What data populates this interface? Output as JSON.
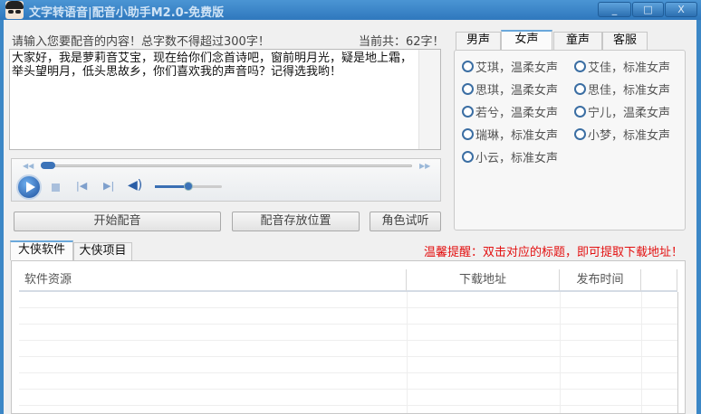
{
  "window": {
    "title": "文字转语音|配音小助手M2.0-免费版",
    "controls": [
      "_",
      "□",
      "X"
    ]
  },
  "input": {
    "prompt": "请输入您要配音的内容！总字数不得超过300字！",
    "count": "当前共：62字！",
    "text": "大家好，我是萝莉音艾宝，现在给你们念首诗吧，窗前明月光，疑是地上霜，举头望明月，低头思故乡，你们喜欢我的声音吗？记得选我哟！"
  },
  "player": {
    "progress": 0.0,
    "volume": 0.5
  },
  "buttons": {
    "start": "开始配音",
    "location": "配音存放位置",
    "preview": "角色试听"
  },
  "voice_tabs": [
    "男声",
    "女声",
    "童声",
    "客服"
  ],
  "voice_tab_active": 1,
  "voices": [
    "艾琪，温柔女声",
    "艾佳，标准女声",
    "思琪，温柔女声",
    "思佳，标准女声",
    "若兮，温柔女声",
    "宁儿，温柔女声",
    "瑞琳，标准女声",
    "小梦，标准女声",
    "小云，标准女声"
  ],
  "bottom_tabs": [
    "大侠软件",
    "大侠项目"
  ],
  "tip": "温馨提醒：双击对应的标题，即可提取下载地址！",
  "table": {
    "columns": [
      "软件资源",
      "下载地址",
      "发布时间",
      ""
    ],
    "rows": []
  }
}
